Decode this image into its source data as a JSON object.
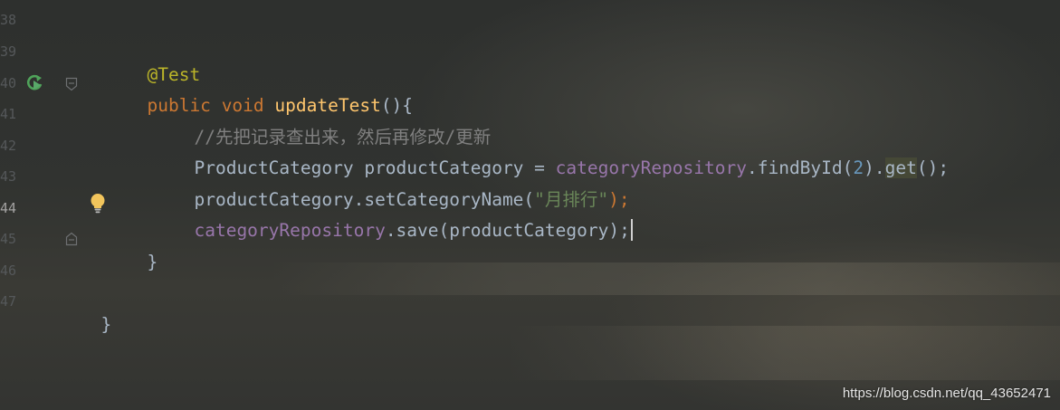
{
  "editor": {
    "line_numbers": [
      "38",
      "39",
      "40",
      "41",
      "42",
      "43",
      "44",
      "45",
      "46",
      "47"
    ],
    "active_line": "44",
    "lines": {
      "l39": {
        "annotation": "@Test"
      },
      "l40": {
        "kw_public": "public",
        "kw_void": "void",
        "method_name": "updateTest",
        "rest": "(){"
      },
      "l41": {
        "comment": "//先把记录查出来，然后再修改/更新"
      },
      "l42": {
        "decl": "ProductCategory productCategory = ",
        "field": "categoryRepository",
        "call": ".findById(",
        "number": "2",
        "close": ").",
        "get": "get",
        "end": "();"
      },
      "l43": {
        "call": "productCategory.setCategoryName(",
        "string": "\"月排行\"",
        "end": ");"
      },
      "l44": {
        "field": "categoryRepository",
        "call": ".save(productCategory);"
      },
      "l45": {
        "brace": "}"
      },
      "l47": {
        "brace": "}"
      }
    },
    "icons": {
      "run": "run-test-icon",
      "fold": "fold-marker-icon",
      "bulb": "intention-bulb-icon"
    },
    "colors": {
      "keyword": "#cc7832",
      "annotation": "#bbb529",
      "method": "#ffc66d",
      "field": "#9876aa",
      "string": "#6a8759",
      "number": "#6897bb",
      "comment": "#808080"
    }
  },
  "watermark": "https://blog.csdn.net/qq_43652471"
}
